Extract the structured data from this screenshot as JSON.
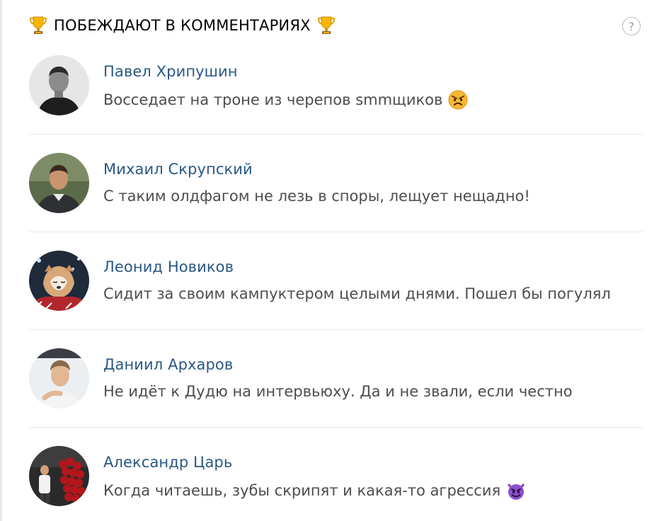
{
  "header": {
    "title": "ПОБЕЖДАЮТ В КОММЕНТАРИЯХ",
    "left_icon": "trophy-icon",
    "right_icon": "trophy-icon",
    "help_label": "?"
  },
  "colors": {
    "name": "#2a5885",
    "text": "#4d4d4d",
    "divider": "#e7e8ec"
  },
  "items": [
    {
      "name": "Павел Хрипушин",
      "text": "Восседает на троне из черепов smmщиков",
      "emoji": "angry-face-icon"
    },
    {
      "name": "Михаил Скрупский",
      "text": "С таким олдфагом не лезь в споры, лещует нещадно!",
      "emoji": ""
    },
    {
      "name": "Леонид Новиков",
      "text": "Сидит за своим кампуктером целыми днями. Пошел бы погулял",
      "emoji": ""
    },
    {
      "name": "Даниил Архаров",
      "text": "Не идёт к Дудю на интервьюху. Да и не звали, если честно",
      "emoji": ""
    },
    {
      "name": "Александр Царь",
      "text": "Когда читаешь, зубы скрипят и какая-то агрессия",
      "emoji": "smiling-devil-icon"
    }
  ]
}
